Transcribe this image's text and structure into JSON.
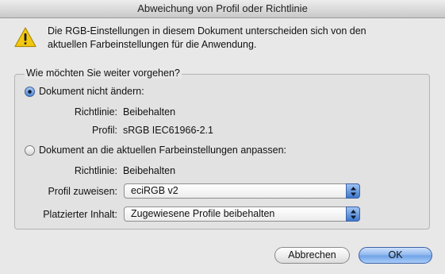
{
  "dialog": {
    "title": "Abweichung von Profil oder Richtlinie",
    "message_line1": "Die RGB-Einstellungen in diesem Dokument unterscheiden sich von den",
    "message_line2": "aktuellen Farbeinstellungen für die Anwendung."
  },
  "group": {
    "title": "Wie möchten Sie weiter vorgehen?",
    "option1": {
      "label": "Dokument nicht ändern:",
      "selected": true,
      "policy_key": "Richtlinie:",
      "policy_value": "Beibehalten",
      "profile_key": "Profil:",
      "profile_value": "sRGB IEC61966-2.1"
    },
    "option2": {
      "label": "Dokument an die aktuellen Farbeinstellungen anpassen:",
      "selected": false,
      "policy_key": "Richtlinie:",
      "policy_value": "Beibehalten",
      "assign_profile_label": "Profil zuweisen:",
      "assign_profile_value": "eciRGB v2",
      "placed_content_label": "Platzierter Inhalt:",
      "placed_content_value": "Zugewiesene Profile beibehalten"
    }
  },
  "buttons": {
    "cancel": "Abbrechen",
    "ok": "OK"
  },
  "icons": {
    "warning": "warning-icon",
    "select_arrows": "updown-arrows-icon"
  },
  "colors": {
    "accent": "#4f86d0",
    "warning_yellow": "#f2c811"
  }
}
